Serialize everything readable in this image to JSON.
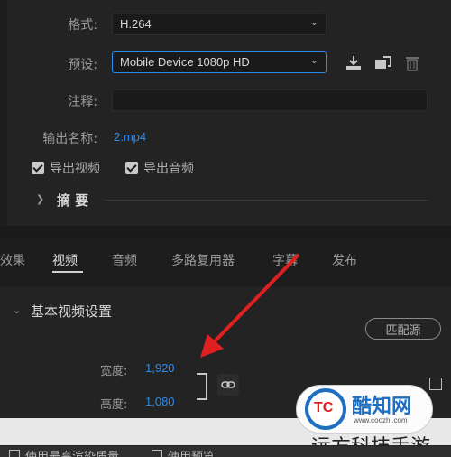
{
  "export": {
    "format_label": "格式:",
    "format_value": "H.264",
    "preset_label": "预设:",
    "preset_value": "Mobile Device 1080p HD",
    "comment_label": "注释:",
    "comment_value": "",
    "output_name_label": "输出名称:",
    "output_name_value": "2.mp4",
    "export_video_label": "导出视频",
    "export_video_checked": true,
    "export_audio_label": "导出音频",
    "export_audio_checked": true,
    "summary_label": "摘 要"
  },
  "tabs": [
    {
      "label": "效果",
      "active": false
    },
    {
      "label": "视频",
      "active": true
    },
    {
      "label": "音频",
      "active": false
    },
    {
      "label": "多路复用器",
      "active": false
    },
    {
      "label": "字幕",
      "active": false
    },
    {
      "label": "发布",
      "active": false
    }
  ],
  "video": {
    "section_title": "基本视频设置",
    "match_source_label": "匹配源",
    "width_label": "宽度:",
    "width_value": "1,920",
    "height_label": "高度:",
    "height_value": "1,080"
  },
  "bottom_row": {
    "max_render_label": "使用最高渲染质量",
    "use_preview_label": "使用预览"
  },
  "watermark": {
    "logo_mark": "TC",
    "site_name": "酷知网",
    "site_url": "www.coozhi.com",
    "caption": "远方科技手游"
  },
  "colors": {
    "accent": "#2d8ceb",
    "arrow": "#e02020",
    "background": "#232323"
  },
  "icons": [
    "chevron-down-icon",
    "import-preset-icon",
    "save-preset-icon",
    "trash-icon",
    "link-icon",
    "chevron-right-icon",
    "red-arrow-annotation"
  ]
}
